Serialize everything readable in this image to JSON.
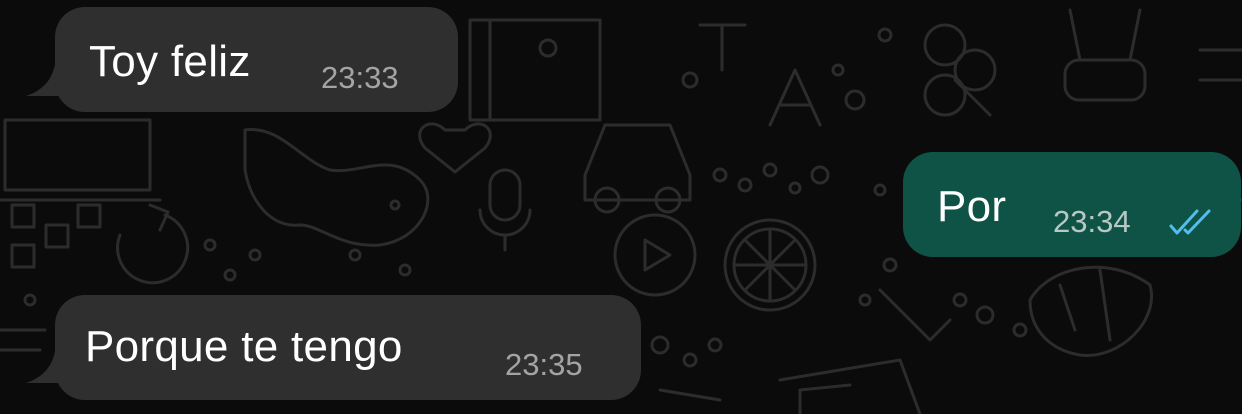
{
  "messages": [
    {
      "direction": "incoming",
      "text": "Toy feliz",
      "time": "23:33"
    },
    {
      "direction": "outgoing",
      "text": "Por",
      "time": "23:34",
      "status": "read",
      "status_icon": "double-check-icon",
      "status_color": "#53bdeb"
    },
    {
      "direction": "incoming",
      "text": "Porque te tengo",
      "time": "23:35"
    }
  ],
  "colors": {
    "background": "#0b0b0b",
    "incoming_bubble": "#2f2f2f",
    "outgoing_bubble": "#0f5346",
    "wallpaper_doodle": "#2a2a2a"
  }
}
